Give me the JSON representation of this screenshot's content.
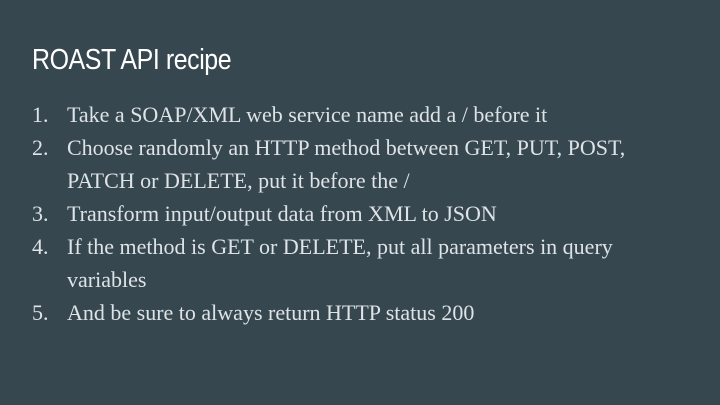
{
  "slide": {
    "title": "ROAST API recipe",
    "steps": [
      {
        "number": "1.",
        "text": "Take a SOAP/XML web service name add a / before it"
      },
      {
        "number": "2.",
        "text": "Choose randomly an HTTP method between GET, PUT, POST, PATCH or DELETE, put it before the /"
      },
      {
        "number": "3.",
        "text": "Transform input/output data from XML to JSON"
      },
      {
        "number": "4.",
        "text": "If the method is GET or DELETE, put all parameters in query variables"
      },
      {
        "number": "5.",
        "text": "And be sure to always return HTTP status 200"
      }
    ]
  },
  "colors": {
    "background": "#37474f",
    "title": "#ffffff",
    "body": "#dde3e6"
  }
}
